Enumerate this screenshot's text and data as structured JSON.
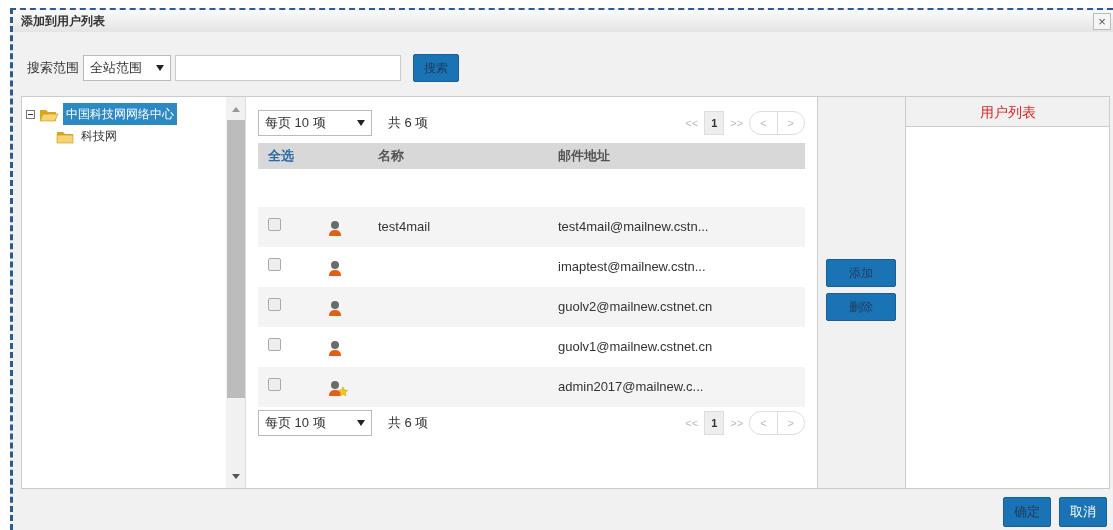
{
  "window": {
    "title": "添加到用户列表",
    "close": "×"
  },
  "search": {
    "label": "搜索范围",
    "scope": "全站范围",
    "button": "搜索"
  },
  "tree": [
    {
      "label": "中国科技网网络中心",
      "expanded": true,
      "selected": true,
      "children": [
        {
          "label": "科技网",
          "expanded": false,
          "selected": false
        }
      ]
    }
  ],
  "pager_top": {
    "page_size": "每页 10 项",
    "total": "共 6 项",
    "first": "<<",
    "page": "1",
    "last": ">>",
    "prev": "<",
    "next": ">"
  },
  "table": {
    "columns": [
      "全选",
      "名称",
      "邮件地址"
    ],
    "rows": [
      {
        "kind": "user",
        "checked": false,
        "name": "test4mail",
        "email": "test4mail@mailnew.cstn..."
      },
      {
        "kind": "user",
        "checked": false,
        "email": "imaptest@mailnew.cstn..."
      },
      {
        "kind": "user",
        "checked": false,
        "email": "guolv2@mailnew.cstnet.cn"
      },
      {
        "kind": "user",
        "checked": false,
        "email": "guolv1@mailnew.cstnet.cn"
      },
      {
        "kind": "admin",
        "checked": false,
        "email": "admin2017@mailnew.c..."
      }
    ]
  },
  "pager_bottom": {
    "page_size": "每页 10 项",
    "total": "共 6 项",
    "first": "<<",
    "page": "1",
    "last": ">>",
    "prev": "<",
    "next": ">"
  },
  "actions": [
    "添加",
    "删除"
  ],
  "user_list": {
    "title": "用户列表"
  },
  "buttons": [
    "确定",
    "取消"
  ]
}
